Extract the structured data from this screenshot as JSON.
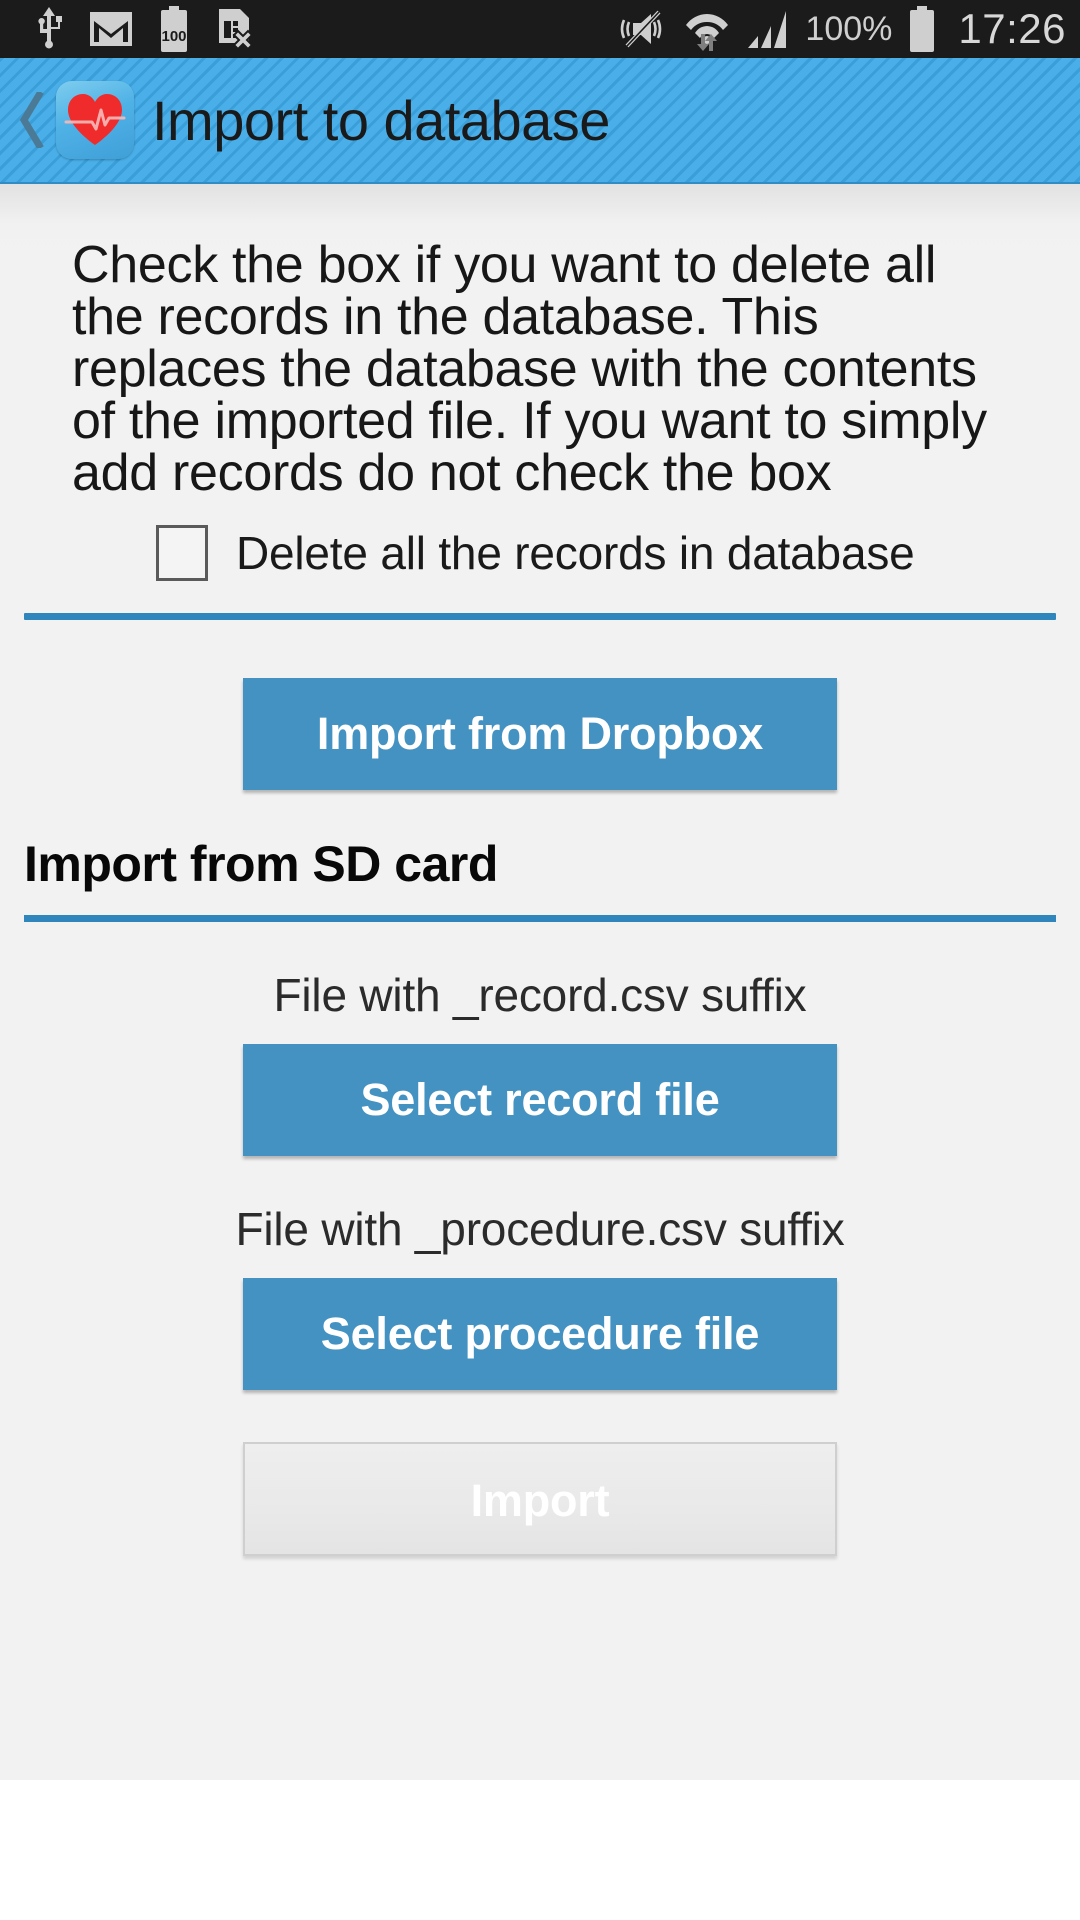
{
  "status_bar": {
    "icons_left": [
      "usb-icon",
      "gmail-icon",
      "battery-100-icon",
      "sim-card-error-icon"
    ],
    "icons_right": [
      "vibrate-mute-icon",
      "wifi-transfer-icon",
      "signal-bars-icon"
    ],
    "battery_percent": "100%",
    "battery_icon": "battery-full-icon",
    "clock": "17:26"
  },
  "action_bar": {
    "back_icon": "back-chevron-icon",
    "app_icon": "heart-pulse-icon",
    "title": "Import to database"
  },
  "main": {
    "intro_text": "Check the box if you want to delete all the records in the database. This replaces the database with the contents of the imported file. If you want to simply add records do not check the box",
    "delete_checkbox": {
      "label": "Delete all the records in database",
      "checked": false
    },
    "dropbox_button": "Import from Dropbox",
    "sd_section_title": "Import from SD card",
    "record_label": "File with _record.csv suffix",
    "record_button": "Select record file",
    "procedure_label": "File with _procedure.csv suffix",
    "procedure_button": "Select procedure file",
    "import_button": "Import",
    "import_button_enabled": false
  },
  "colors": {
    "accent_blue": "#4392c2",
    "rule_blue": "#2f86bd",
    "action_bar_blue": "#4aafe8",
    "heart_red": "#ef2b2b",
    "content_bg": "#f2f2f2",
    "status_bar_bg": "#1b1b1b",
    "disabled_bg": "#e9e9e9"
  }
}
